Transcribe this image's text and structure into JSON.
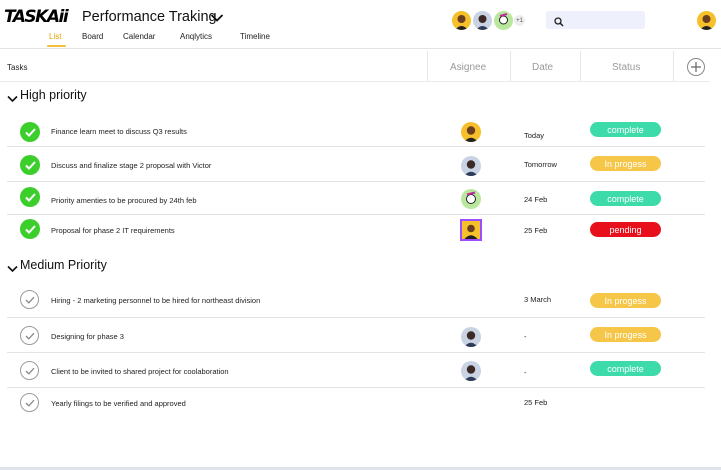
{
  "app": {
    "logo": "TASKAii"
  },
  "header": {
    "project_title": "Performance Traking",
    "nav": [
      "List",
      "Board",
      "Calendar",
      "Anqlytics",
      "Timeline"
    ],
    "team_extra_count": "+1"
  },
  "table": {
    "columns": {
      "tasks": "Tasks",
      "assignee": "Asignee",
      "date": "Date",
      "status": "Status"
    }
  },
  "sections": [
    {
      "title": "High priority",
      "tasks": [
        {
          "text": "Finance learn meet to discuss Q3 results",
          "date": "Today",
          "status": "complete"
        },
        {
          "text": "Discuss and finalize stage 2 proposal with Victor",
          "date": "Tomorrow",
          "status": "In progess"
        },
        {
          "text": "Priority amenties to be procured by 24th feb",
          "date": "24 Feb",
          "status": "complete"
        },
        {
          "text": "Proposal for phase 2 IT requirements",
          "date": "25 Feb",
          "status": "pending"
        }
      ]
    },
    {
      "title": "Medium Priority",
      "tasks": [
        {
          "text": "Hiring - 2 marketing personnel to be hired for northeast division",
          "date": "3 March",
          "status": "In progess"
        },
        {
          "text": "Designing for phase 3",
          "date": "-",
          "status": "In progess"
        },
        {
          "text": "Client to be invited to shared project for coolaboration",
          "date": "-",
          "status": "complete"
        },
        {
          "text": "Yearly filings to be verified and approved",
          "date": "25 Feb",
          "status": ""
        }
      ]
    }
  ],
  "colors": {
    "complete": "#3ddba9",
    "in_progress": "#f6c648",
    "pending": "#e8101a",
    "check_done": "#3ccf2c",
    "accent": "#e2a400"
  },
  "icons": [
    "chevron-down-icon",
    "search-icon",
    "plus-icon",
    "check-icon",
    "avatar"
  ]
}
